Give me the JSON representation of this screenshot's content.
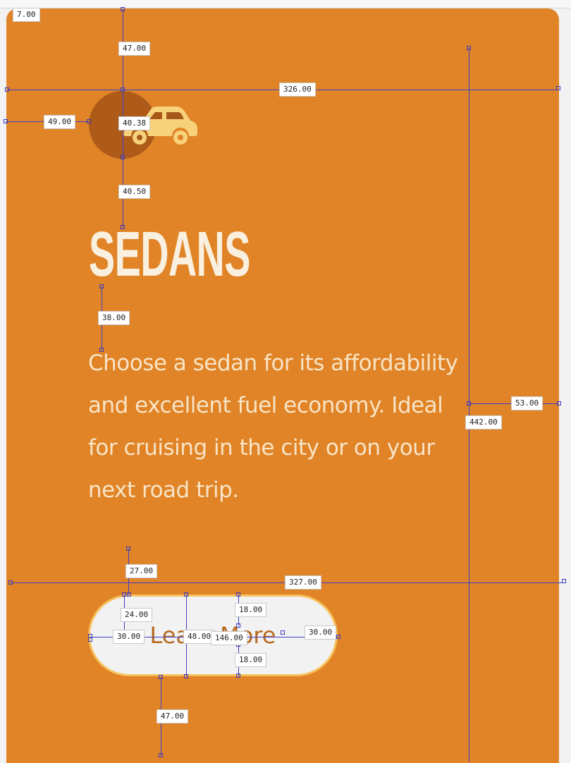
{
  "card": {
    "title": "SEDANS",
    "description": "Choose a sedan for its affordability and excellent fuel economy. Ideal for cruising in the city or on your next road trip.",
    "button_label": "Learn More",
    "icon": "car-icon"
  },
  "colors": {
    "card_background": "#e08427",
    "icon_circle": "#a8571a",
    "icon_fill": "#f8d27a",
    "title_color": "#faf0df",
    "text_color": "#f9e4c6",
    "button_background": "#f2f2f2",
    "button_border": "#f6c25e",
    "measure_line": "#4040c8"
  },
  "measurements": {
    "m_top_corner": "7.00",
    "m_top_47": "47.00",
    "m_width_326": "326.00",
    "m_left_49": "49.00",
    "m_icon_40_38": "40.38",
    "m_icon_40_50": "40.50",
    "m_title_38": "38.00",
    "m_right_53": "53.00",
    "m_height_442": "442.00",
    "m_gap_27": "27.00",
    "m_width_327": "327.00",
    "m_btn_24": "24.00",
    "m_btn_18_top": "18.00",
    "m_btn_30_left": "30.00",
    "m_btn_48": "48.00",
    "m_btn_146": "146.00",
    "m_btn_30_right": "30.00",
    "m_btn_18_bottom": "18.00",
    "m_bottom_47": "47.00"
  }
}
